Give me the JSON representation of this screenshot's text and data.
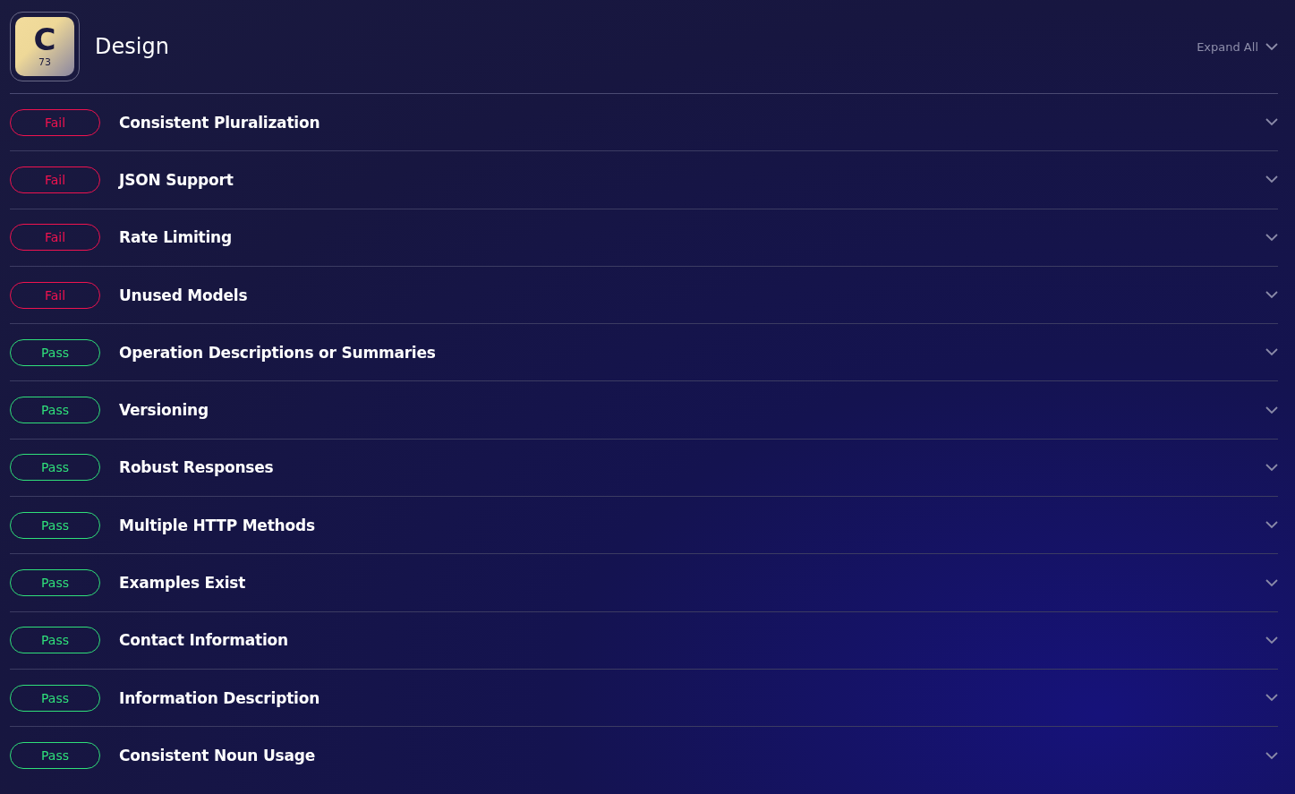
{
  "header": {
    "badge": {
      "letter": "C",
      "number": "73"
    },
    "title": "Design",
    "expand_all": "Expand All"
  },
  "checks": [
    {
      "status": "Fail",
      "kind": "fail",
      "name": "Consistent Pluralization",
      "expanded": false
    },
    {
      "status": "Fail",
      "kind": "fail",
      "name": "JSON Support",
      "expanded": false
    },
    {
      "status": "Fail",
      "kind": "fail",
      "name": "Rate Limiting",
      "expanded": false
    },
    {
      "status": "Fail",
      "kind": "fail",
      "name": "Unused Models",
      "expanded": false
    },
    {
      "status": "Pass",
      "kind": "pass",
      "name": "Operation Descriptions or Summaries",
      "expanded": false
    },
    {
      "status": "Pass",
      "kind": "pass",
      "name": "Versioning",
      "expanded": false
    },
    {
      "status": "Pass",
      "kind": "pass",
      "name": "Robust Responses",
      "expanded": false
    },
    {
      "status": "Pass",
      "kind": "pass",
      "name": "Multiple HTTP Methods",
      "expanded": false
    },
    {
      "status": "Pass",
      "kind": "pass",
      "name": "Examples Exist",
      "expanded": false
    },
    {
      "status": "Pass",
      "kind": "pass",
      "name": "Contact Information",
      "expanded": false
    },
    {
      "status": "Pass",
      "kind": "pass",
      "name": "Information Description",
      "expanded": false
    },
    {
      "status": "Pass",
      "kind": "pass",
      "name": "Consistent Noun Usage",
      "expanded": false
    }
  ]
}
